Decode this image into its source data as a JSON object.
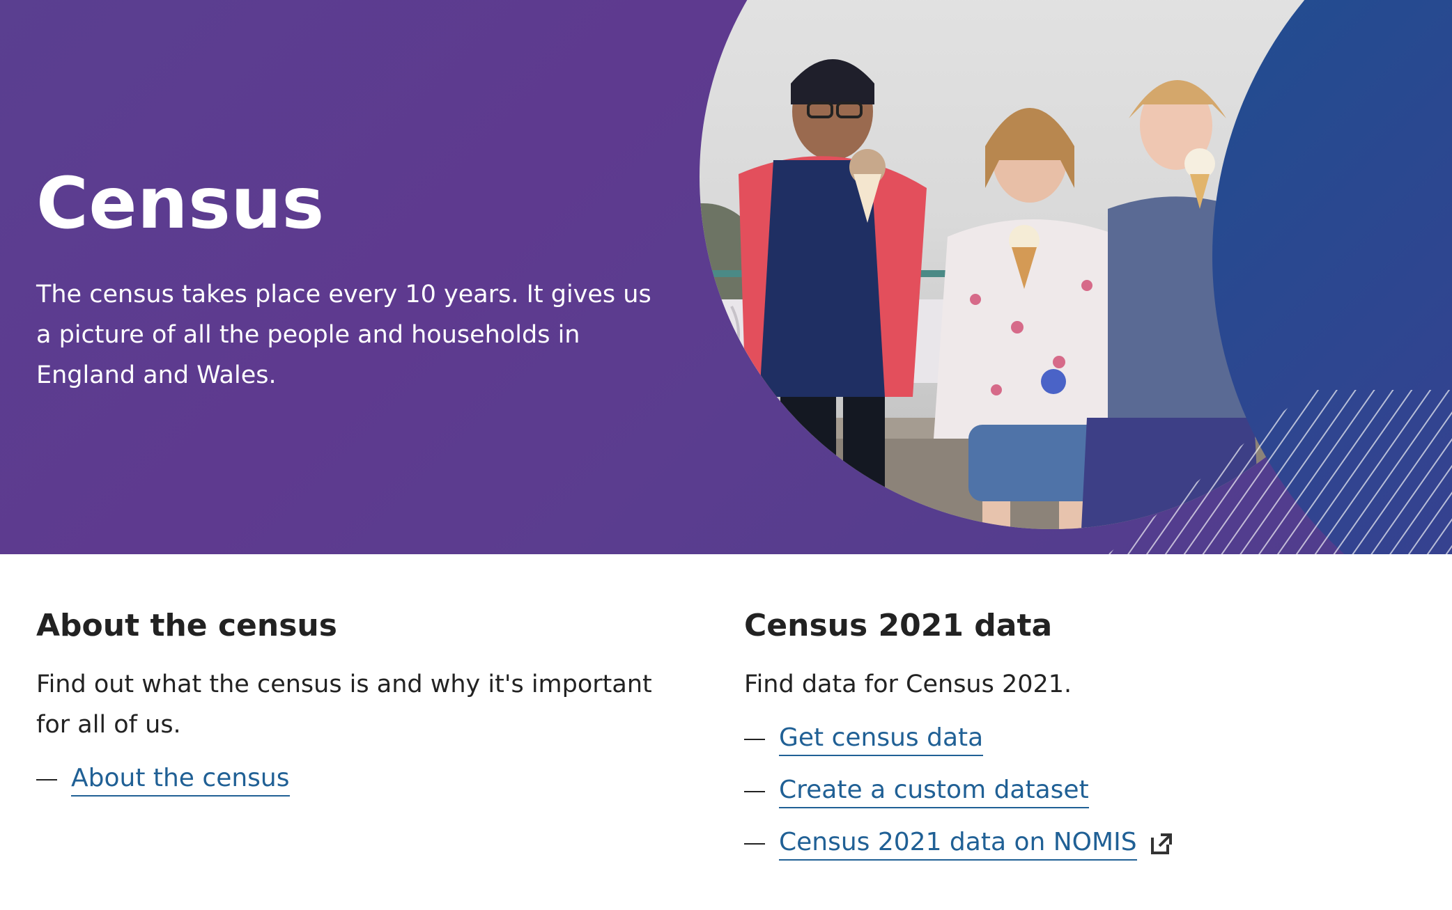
{
  "hero": {
    "title": "Census",
    "lead": "The census takes place every 10 years. It gives us a picture of all the people and households in England and Wales.",
    "image_description_alt": "Three children eating ice cream on a pier"
  },
  "sections": {
    "about": {
      "heading": "About the census",
      "text": "Find out what the census is and why it's important for all of us.",
      "links": [
        {
          "label": "About the census"
        }
      ]
    },
    "data": {
      "heading": "Census 2021 data",
      "text": "Find data for Census 2021.",
      "links": [
        {
          "label": "Get census data"
        },
        {
          "label": "Create a custom dataset"
        },
        {
          "label": "Census 2021 data on NOMIS",
          "icon": "external-link-icon"
        }
      ]
    }
  },
  "colors": {
    "hero_purple": "#5b3d8f",
    "hero_blue": "#27438b",
    "link": "#206095",
    "text": "#222222"
  }
}
